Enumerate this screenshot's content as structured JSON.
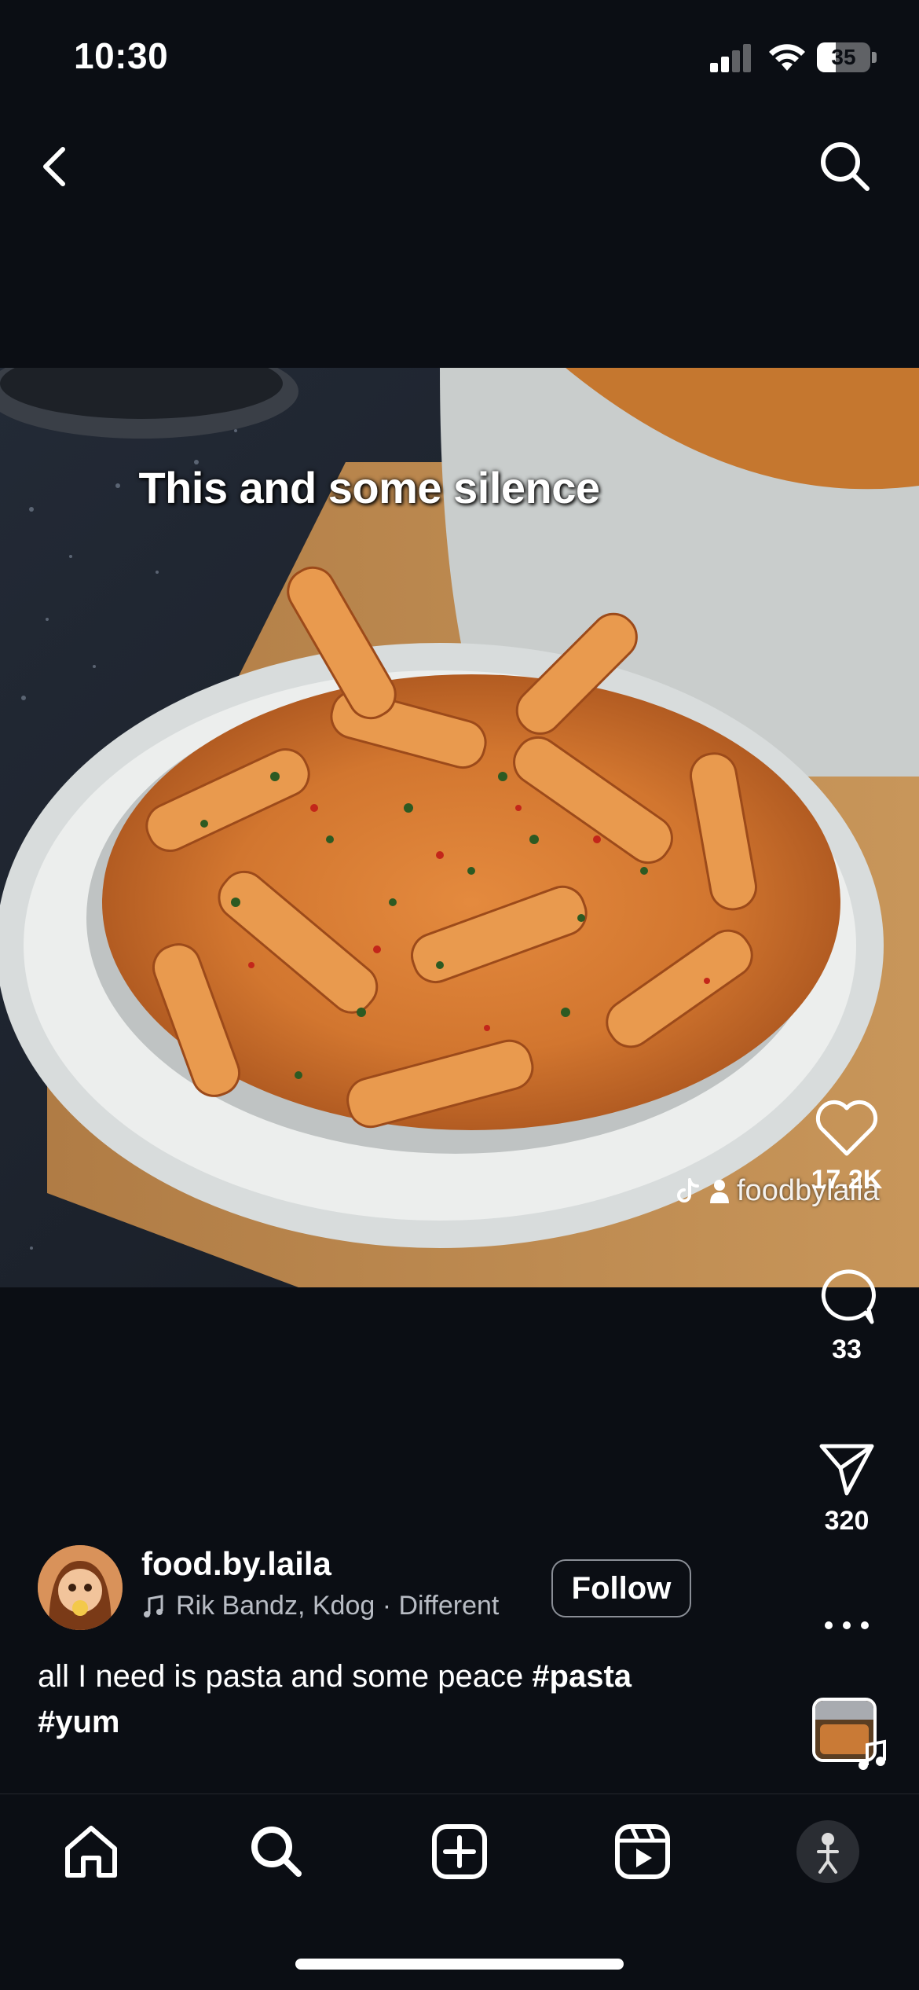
{
  "status_bar": {
    "time": "10:30",
    "battery": "35"
  },
  "post": {
    "overlay_text": "This and some silence",
    "watermark": "foodbylaila",
    "likes": "17.2K",
    "comments": "33",
    "shares": "320"
  },
  "author": {
    "username": "food.by.laila",
    "audio": "Rik Bandz, Kdog · Different",
    "follow_label": "Follow"
  },
  "caption": {
    "text": "all I need is pasta and some peace",
    "tags": [
      "#pasta",
      "#yum"
    ]
  },
  "icons": {
    "back": "chevron-left-icon",
    "search": "search-icon",
    "like": "heart-icon",
    "comment": "comment-icon",
    "share": "send-icon",
    "more": "more-horizontal-icon",
    "music": "music-note-icon",
    "home": "home-icon",
    "explore": "search-icon",
    "create": "plus-square-icon",
    "reels": "reels-icon",
    "profile": "avatar"
  },
  "colors": {
    "background": "#0b0e14",
    "text": "#ffffff",
    "muted": "#b8bcc4"
  }
}
